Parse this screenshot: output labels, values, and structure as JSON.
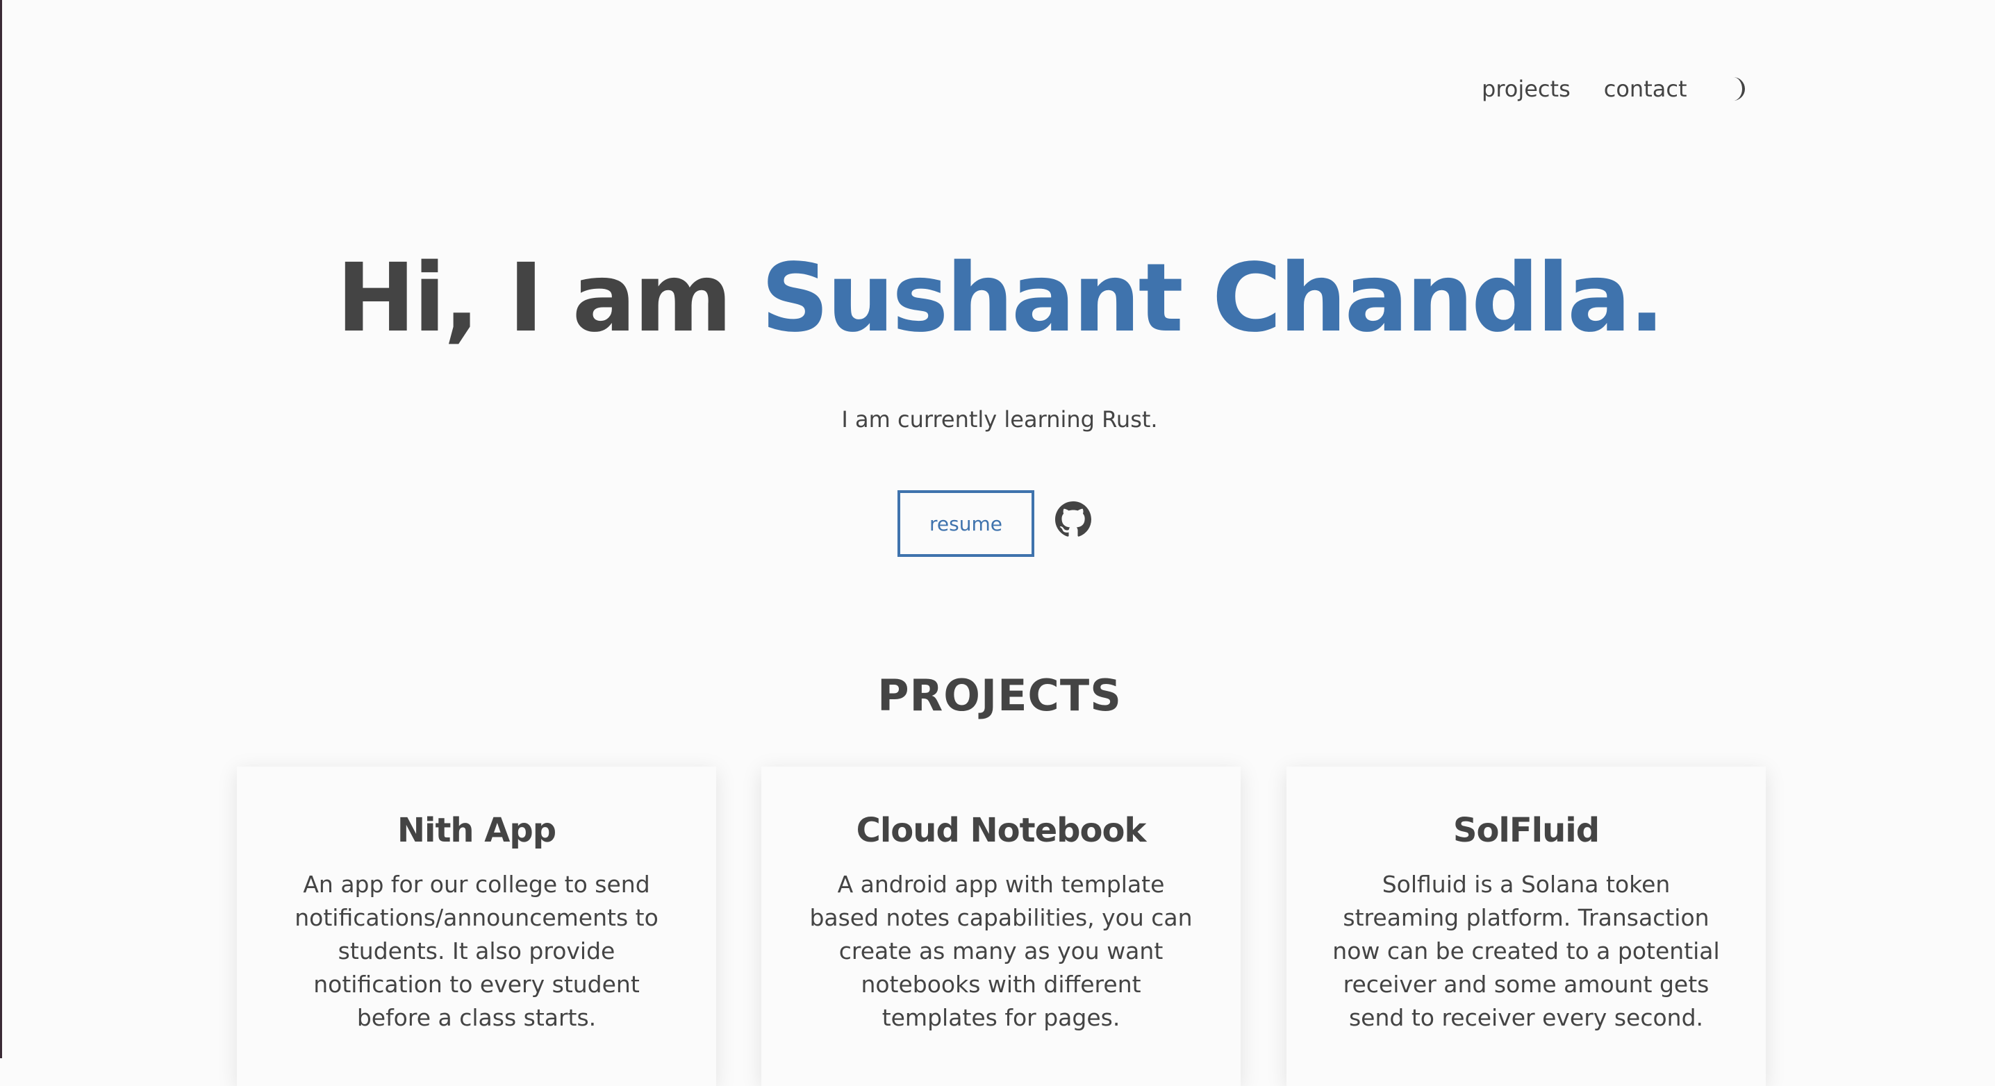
{
  "nav": {
    "projects": "projects",
    "contact": "contact",
    "theme_icon": "half-moon-icon"
  },
  "hero": {
    "greeting": "Hi, I am ",
    "name": "Sushant Chandla.",
    "subtitle": "I am currently learning Rust.",
    "resume_label": "resume",
    "github_icon": "github-icon"
  },
  "projects": {
    "heading": "PROJECTS",
    "items": [
      {
        "title": "Nith App",
        "description": "An app for our college to send notifications/announcements to students. It also provide notification to every student before a class starts."
      },
      {
        "title": "Cloud Notebook",
        "description": "A android app with template based notes capabilities, you can create as many as you want notebooks with different templates for pages."
      },
      {
        "title": "SolFluid",
        "description": "Solfluid is a Solana token streaming platform. Transaction now can be created to a potential receiver and some amount gets send to receiver every second."
      }
    ]
  },
  "colors": {
    "accent": "#3f73ad",
    "text": "#444444",
    "background": "#fbfbfb"
  }
}
